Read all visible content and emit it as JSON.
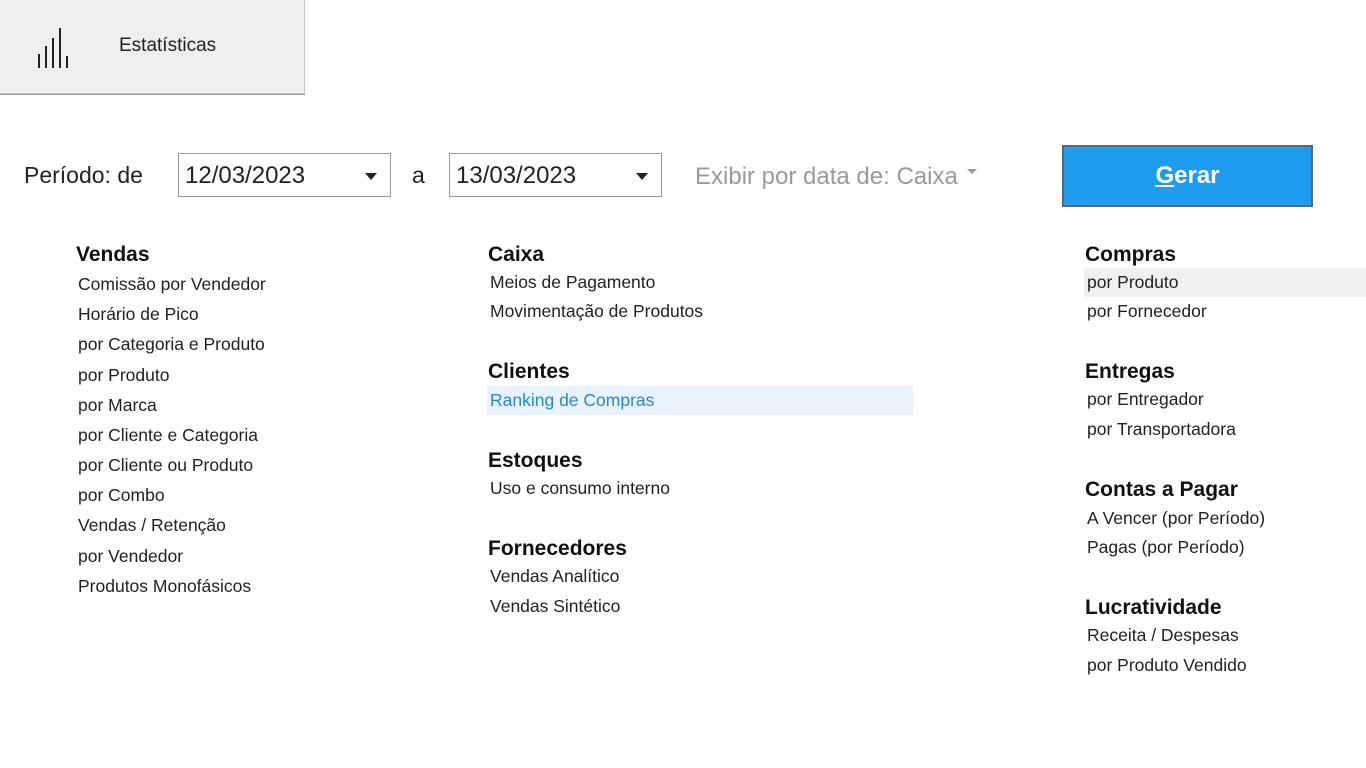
{
  "tab": {
    "label": "Estatísticas",
    "icon": "bar-chart-icon"
  },
  "period": {
    "label": "Período: de",
    "from": "12/03/2023",
    "to_label": "a",
    "to": "13/03/2023",
    "display_by": "Exibir por data de: Caixa"
  },
  "generate": {
    "mnemonic": "G",
    "rest": "erar"
  },
  "colors": {
    "accent": "#1e9cf0",
    "link_highlight": "#2a86d1"
  },
  "sections": {
    "vendas": {
      "title": "Vendas",
      "items": [
        "Comissão por Vendedor",
        "Horário de Pico",
        "por Categoria e Produto",
        "por Produto",
        "por Marca",
        "por Cliente e Categoria",
        "por Cliente ou Produto",
        "por Combo",
        "Vendas / Retenção",
        "por Vendedor",
        "Produtos Monofásicos"
      ]
    },
    "caixa": {
      "title": "Caixa",
      "items": [
        "Meios de Pagamento",
        "Movimentação de Produtos"
      ]
    },
    "clientes": {
      "title": "Clientes",
      "items": [
        "Ranking de Compras"
      ]
    },
    "estoques": {
      "title": "Estoques",
      "items": [
        "Uso e consumo interno"
      ]
    },
    "fornecedores": {
      "title": "Fornecedores",
      "items": [
        "Vendas Analítico",
        "Vendas Sintético"
      ]
    },
    "compras": {
      "title": "Compras",
      "items": [
        "por Produto",
        "por Fornecedor"
      ]
    },
    "entregas": {
      "title": "Entregas",
      "items": [
        "por Entregador",
        "por Transportadora"
      ]
    },
    "contas": {
      "title": "Contas a Pagar",
      "items": [
        "A Vencer (por Período)",
        "Pagas (por Período)"
      ]
    },
    "lucratividade": {
      "title": "Lucratividade",
      "items": [
        "Receita / Despesas",
        "por Produto Vendido"
      ]
    }
  }
}
